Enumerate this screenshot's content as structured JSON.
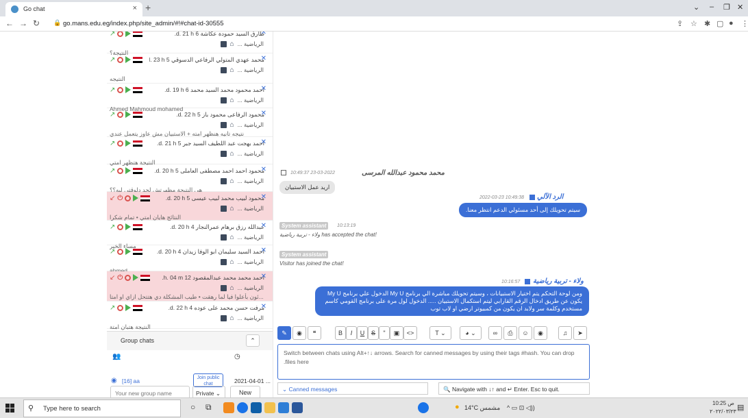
{
  "browser": {
    "tab_title": "Go chat",
    "url": "go.mans.edu.eg/index.php/site_admin/#!#chat-id-30555"
  },
  "chats": [
    {
      "name": "طارق السيد حمودة عكاشة",
      "num": "6",
      "time": "d. 21 h.",
      "dept": "الرياضية ...",
      "preview": "النتيجة؟",
      "red": false
    },
    {
      "name": "محمد عهدي المتولي الرفاعي الدسوقي",
      "num": "5",
      "time": "d. 23 h.",
      "dept": "الرياضية ...",
      "preview": "النتيجه",
      "red": false
    },
    {
      "name": "احمد محمود محمد السيد محمد",
      "num": "6",
      "time": "d. 19 h.",
      "dept": "الرياضية ...",
      "preview": "Ahmed Mahmoud mohamed",
      "red": false
    },
    {
      "name": "محمود الرفاعى محمود باز",
      "num": "5",
      "time": "d. 22 h.",
      "dept": "الرياضية ...",
      "preview": "نتيجه تانيه هنظهر امته + الاستبيان مش عاوز يتعمل عندي",
      "red": false
    },
    {
      "name": "احمد بهجت عبد اللطيف السيد جبر",
      "num": "5",
      "time": "d. 21 h.",
      "dept": "الرياضية ...",
      "preview": "النتيجة هتظهر امتي",
      "red": false
    },
    {
      "name": "محمود احمد احمد مصطفى العاملى",
      "num": "5",
      "time": "d. 20 h.",
      "dept": "الرياضية ...",
      "preview": "هي النتيجة مظهرتش لحد دلوقتي ليه؟؟",
      "red": false
    },
    {
      "name": "محمود لبيب محمد لبيب عيسى",
      "num": "5",
      "time": "d. 20 h.",
      "dept": "الرياضية ...",
      "preview": "النتائج هايان امتي • تمام شكرا",
      "red": true
    },
    {
      "name": "عبدالله رزق برهام عمرالنجار",
      "num": "4",
      "time": "d. 20 h.",
      "dept": "الرياضية ...",
      "preview": "مساء الخير",
      "red": false
    },
    {
      "name": "احمد السيد سليمان ابو الوفا زيدان",
      "num": "4",
      "time": "d. 20 h.",
      "dept": "الرياضية ...",
      "preview": "ahmed",
      "red": false
    },
    {
      "name": "احمد محمد محمد عبدالمقصود",
      "num": "12",
      "time": "h. 04 m.",
      "dept": "الرياضية ...",
      "preview": "...ئون بأعلوا فيا لما رهقت • طيب المشكلة دي هتتحل ازاي او امتا",
      "red": true
    },
    {
      "name": "مرفت حسن محمد على عوده",
      "num": "4",
      "time": "d. 22 h.",
      "dept": "الرياضية ...",
      "preview": "النتيجة هتبان امتة",
      "red": false
    }
  ],
  "group": {
    "heading": "Group chats",
    "row_name": "[16] aa",
    "join_label": "Join public chat",
    "row_date": "2021-04-01 ...",
    "new_placeholder": "Your new group name",
    "privacy": "Private",
    "new_btn": "New"
  },
  "messages": {
    "visitor_name": "محمد محمود عبدالله المرسى",
    "visitor_time": "10:49:37 23-03-2022",
    "visitor_msg": "اريد عمل الاستبيان",
    "bot_name": "الرد الآلي",
    "bot_time": "2022-03-23 10:49:38",
    "bot_msg": "سيتم تحويلك إلى أحد مسئولي الدعم انتظر معنا.",
    "sys_label": "System assistant",
    "sys_time1": "10:13:19",
    "sys1": "ولاء - تربية رياضية has accepted the chat!",
    "sys2": "Visitor has joined the chat!",
    "op_name": "ولاء - تربية رياضية",
    "op_time": "10:16:57",
    "op_msg": "ومن لوحة التحكم يتم اختيار الاستبيانات ، وسيتم تحويلك مباشرة الي برنامج My U الدخول علي برنامج My U يكون عن طريق ادخال الرقم القارابي ليتم استكمال الاستبيان ..... الدخول لول مرة على برنامج القومي كاسم مستخدم وكلمة سر ولابد ان يكون من كمبيوتر ارضي او لاب توب"
  },
  "composer": {
    "placeholder": "Switch between chats using Alt+↑↓ arrows. Search for canned messages by using their tags #hash. You can drop files here.",
    "canned": "Canned messages",
    "nav_hint": "Navigate with ↓↑ and ↵ Enter. Esc to quit."
  },
  "taskbar": {
    "search": "Type here to search",
    "weather": "14°C مشمس",
    "time": "10:25 ص",
    "date": "٢٠٢٢/٠٣/٢٣"
  }
}
